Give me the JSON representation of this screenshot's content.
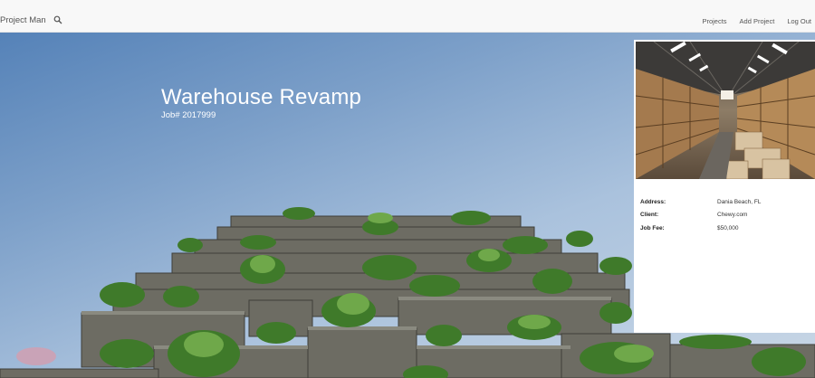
{
  "navbar": {
    "brand": "Project Man",
    "links": [
      "Projects",
      "Add Project",
      "Log Out"
    ]
  },
  "project": {
    "title": "Warehouse Revamp",
    "job_number": "Job# 2017999"
  },
  "details": [
    {
      "label": "Address:",
      "value": "Dania Beach, FL"
    },
    {
      "label": "Client:",
      "value": "Chewy.com"
    },
    {
      "label": "Job Fee:",
      "value": "$50,000"
    }
  ],
  "colors": {
    "navbar_bg": "#f8f8f8",
    "sky_top": "#5582b8",
    "sky_bottom": "#c9d7e6",
    "card_bg": "#ffffff"
  },
  "icons": {
    "search": "search-icon"
  }
}
